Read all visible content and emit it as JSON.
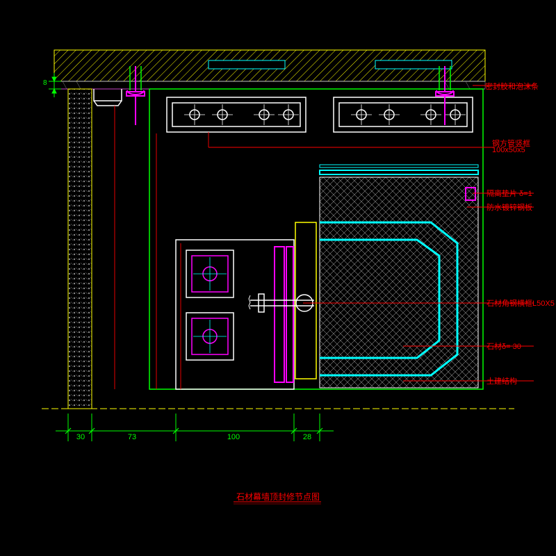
{
  "title": "石材幕墙顶封修节点图",
  "annotations": {
    "sealant": "密封胶和泡沫条",
    "tube_l1": "钢方管竖框",
    "tube_l2": "100x50x5",
    "gasket": "隔离垫片 δ=1",
    "galv_plate": "防水镀锌钢板",
    "angle_steel": "石材角钢横框L50X5",
    "stone": "石材δ= 30",
    "structure": "土建结构"
  },
  "dimensions": {
    "d1": "30",
    "d2": "73",
    "d3": "100",
    "d4": "28",
    "gap": "8"
  }
}
